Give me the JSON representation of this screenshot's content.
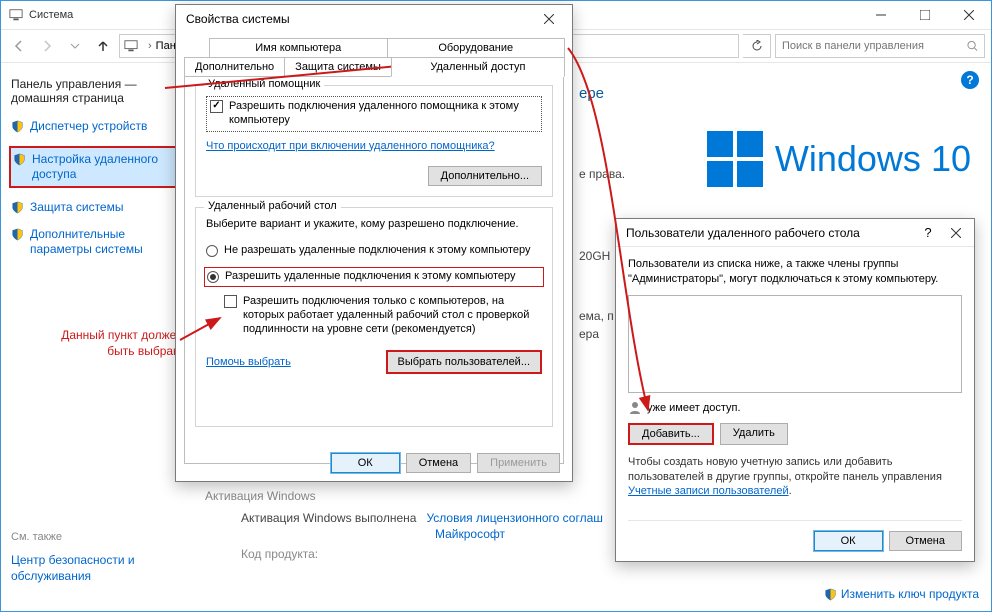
{
  "explorer": {
    "title": "Система",
    "breadcrumb_segment": "Пан",
    "search_placeholder": "Поиск в панели управления"
  },
  "leftpane": {
    "home": "Панель управления — домашняя страница",
    "items": [
      {
        "label": "Диспетчер устройств"
      },
      {
        "label": "Настройка удаленного доступа"
      },
      {
        "label": "Защита системы"
      },
      {
        "label": "Дополнительные параметры системы"
      }
    ],
    "seealso_title": "См. также",
    "seealso_link": "Центр безопасности и обслуживания"
  },
  "annotation_text": "Данный пункт должен быть выбран!",
  "background": {
    "heading_suffix": "ере",
    "rows": {
      "r1": "е права.",
      "r2": "20GH",
      "r3": "ема, п",
      "r4": "ера"
    },
    "edition_label": "Windows",
    "edition_num": "10",
    "activation_label": "Активация Windows",
    "activation_text": "Активация Windows выполнена",
    "activation_link1": "Условия лицензионного соглаш",
    "activation_link2": "Майкрософт",
    "product_code_label": "Код продукта:",
    "changekey_link": "Изменить ключ продукта"
  },
  "sysdlg": {
    "title": "Свойства системы",
    "tabs_row1": [
      "Имя компьютера",
      "Оборудование"
    ],
    "tabs_row2": [
      "Дополнительно",
      "Защита системы",
      "Удаленный доступ"
    ],
    "group1": {
      "legend": "Удаленный помощник",
      "checkbox": "Разрешить подключения удаленного помощника к этому компьютеру",
      "link": "Что происходит при включении удаленного помощника?",
      "btn": "Дополнительно..."
    },
    "group2": {
      "legend": "Удаленный рабочий стол",
      "intro": "Выберите вариант и укажите, кому разрешено подключение.",
      "radio_deny": "Не разрешать удаленные подключения к этому компьютеру",
      "radio_allow": "Разрешить удаленные подключения к этому компьютеру",
      "checkbox_nla": "Разрешить подключения только с компьютеров, на которых работает удаленный рабочий стол с проверкой подлинности на уровне сети (рекомендуется)",
      "link_help": "Помочь выбрать",
      "btn_users": "Выбрать пользователей..."
    },
    "buttons": {
      "ok": "ОК",
      "cancel": "Отмена",
      "apply": "Применить"
    }
  },
  "usersdlg": {
    "title": "Пользователи удаленного рабочего стола",
    "intro": "Пользователи из списка ниже, а также члены группы \"Администраторы\", могут подключаться к этому компьютеру.",
    "already": "уже имеет доступ.",
    "btn_add": "Добавить...",
    "btn_remove": "Удалить",
    "note_prefix": "Чтобы создать новую учетную запись или добавить пользователей в другие группы, откройте панель управления ",
    "note_link": "Учетные записи пользователей",
    "buttons": {
      "ok": "ОК",
      "cancel": "Отмена"
    }
  }
}
